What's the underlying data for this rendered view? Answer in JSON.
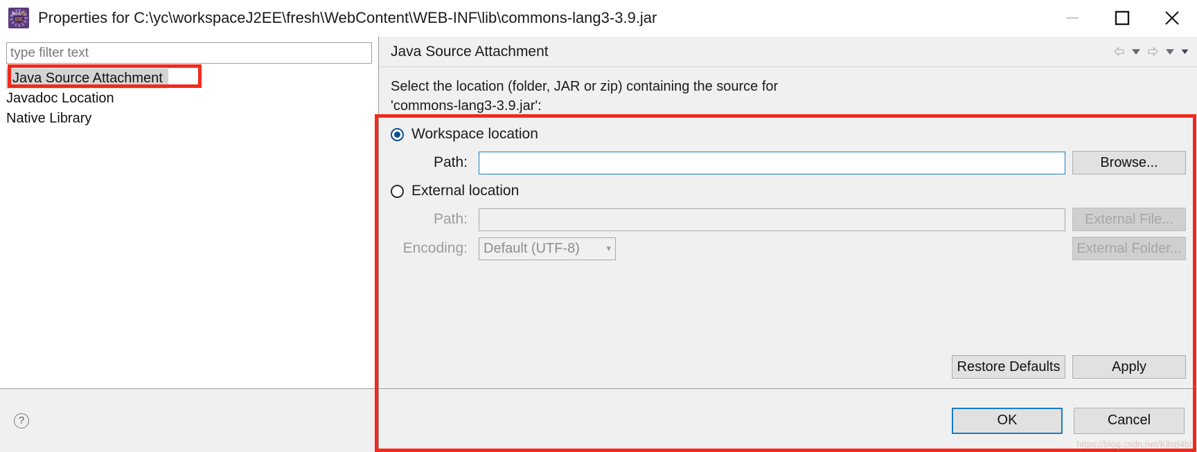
{
  "window": {
    "title": "Properties for C:\\yc\\workspaceJ2EE\\fresh\\WebContent\\WEB-INF\\lib\\commons-lang3-3.9.jar",
    "app_icon": "eclipse-java-ee-ide-icon",
    "icon_text_top": "Java",
    "icon_text_ee": "EE",
    "icon_text_ide": "IDE",
    "controls": {
      "minimize": "Minimize",
      "maximize": "Maximize",
      "close": "Close"
    }
  },
  "sidebar": {
    "filter": {
      "value": "",
      "placeholder": "type filter text"
    },
    "items": [
      {
        "label": "Java Source Attachment",
        "selected": true
      },
      {
        "label": "Javadoc Location",
        "selected": false
      },
      {
        "label": "Native Library",
        "selected": false
      }
    ],
    "help_icon": "?"
  },
  "main": {
    "header": {
      "title": "Java Source Attachment",
      "nav": [
        {
          "icon": "back-arrow-icon"
        },
        {
          "icon": "chevron-down-icon"
        },
        {
          "icon": "forward-arrow-icon"
        },
        {
          "icon": "chevron-down-icon"
        },
        {
          "icon": "chevron-down-small-icon"
        }
      ]
    },
    "description_line1": "Select the location (folder, JAR or zip) containing the source for",
    "description_line2": "'commons-lang3-3.9.jar':",
    "workspace": {
      "radio_label": "Workspace location",
      "selected": true,
      "path_label": "Path:",
      "path_value": "",
      "browse_button": "Browse..."
    },
    "external": {
      "radio_label": "External location",
      "selected": false,
      "path_label": "Path:",
      "path_value": "",
      "external_file_button": "External File...",
      "encoding_label": "Encoding:",
      "encoding_value": "Default (UTF-8)",
      "external_folder_button": "External Folder..."
    },
    "restore_defaults_button": "Restore Defaults",
    "apply_button": "Apply"
  },
  "footer": {
    "ok_button": "OK",
    "cancel_button": "Cancel"
  },
  "watermark": "https://blog.csdn.net/Klhzl4bl",
  "colors": {
    "accent_blue": "#1b7bc4",
    "radio_blue": "#0f4f8f",
    "annotation_red": "#f22a1c",
    "panel_gray": "#f0f0f0",
    "selection_gray": "#d4d4d4"
  }
}
